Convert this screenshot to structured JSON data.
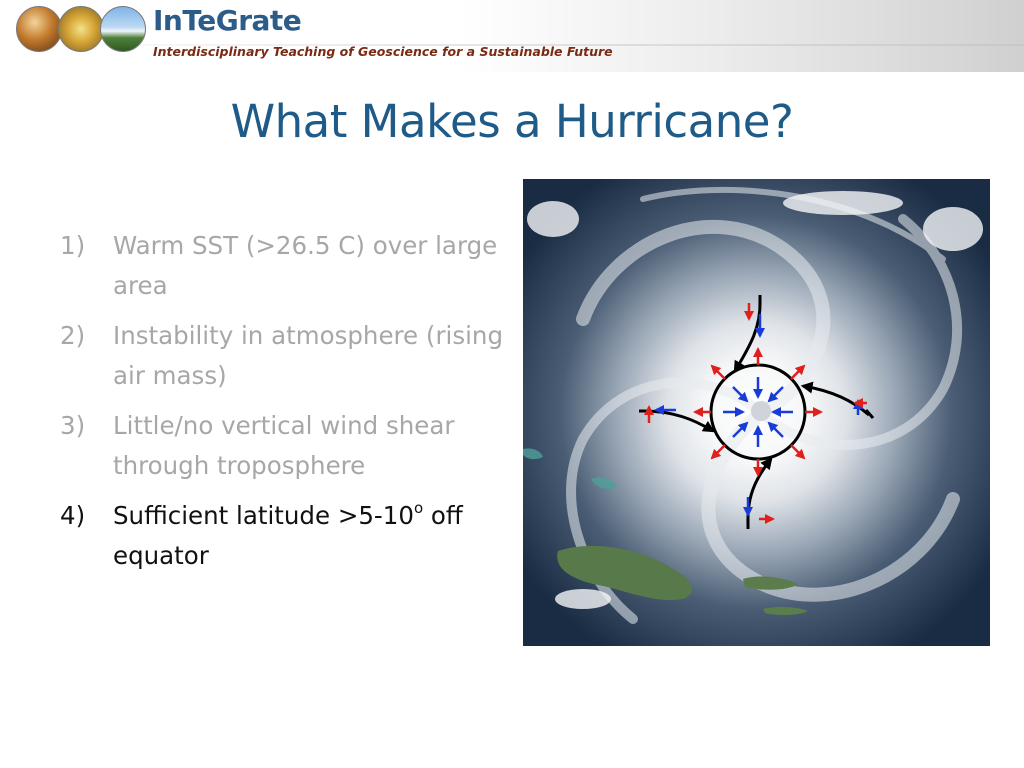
{
  "header": {
    "brand_title": "InTeGrate",
    "tagline": "Interdisciplinary Teaching of Geoscience for a Sustainable Future"
  },
  "slide": {
    "title": "What Makes a Hurricane?"
  },
  "bullets": [
    {
      "num": "1)",
      "text": "Warm SST (>26.5 C) over large area",
      "state": "dim"
    },
    {
      "num": "2)",
      "text": "Instability in atmosphere (rising air mass)",
      "state": "dim"
    },
    {
      "num": "3)",
      "text": "Little/no vertical wind shear through troposphere",
      "state": "dim"
    },
    {
      "num": "4)",
      "text_before": "Sufficient latitude >5-10",
      "superscript": "o",
      "text_after": " off equator",
      "state": "active"
    }
  ],
  "colors": {
    "title": "#1f5b88",
    "brand": "#2b5c8a",
    "tagline": "#7a2a12",
    "bullet_dim": "#a7a7a7",
    "bullet_active": "#111111",
    "arrow_inflow": "#1a3cd6",
    "arrow_outflow": "#e0201c",
    "arrow_black": "#000000"
  }
}
